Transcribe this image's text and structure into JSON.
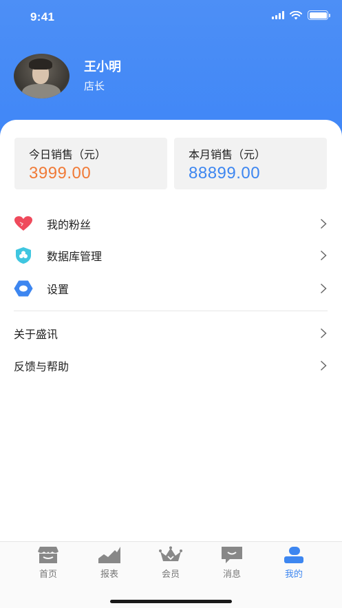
{
  "status_bar": {
    "time": "9:41"
  },
  "profile": {
    "name": "王小明",
    "role": "店长"
  },
  "stats": [
    {
      "label": "今日销售（元）",
      "value": "3999.00",
      "color": "#f07a37"
    },
    {
      "label": "本月销售（元）",
      "value": "88899.00",
      "color": "#3d86f0"
    }
  ],
  "menu": {
    "items": [
      {
        "label": "我的粉丝",
        "icon": "heart-icon"
      },
      {
        "label": "数据库管理",
        "icon": "shield-database-icon"
      },
      {
        "label": "设置",
        "icon": "settings-hexagon-icon"
      }
    ],
    "plain_items": [
      {
        "label": "关于盛讯"
      },
      {
        "label": "反馈与帮助"
      }
    ]
  },
  "tabbar": {
    "tabs": [
      {
        "label": "首页",
        "icon": "shop-icon",
        "active": false
      },
      {
        "label": "报表",
        "icon": "chart-icon",
        "active": false
      },
      {
        "label": "会员",
        "icon": "crown-icon",
        "active": false
      },
      {
        "label": "消息",
        "icon": "message-icon",
        "active": false
      },
      {
        "label": "我的",
        "icon": "user-icon",
        "active": true
      }
    ]
  },
  "colors": {
    "accent": "#3d86f0",
    "header": "#4d8ff6",
    "orange": "#f07a37"
  }
}
